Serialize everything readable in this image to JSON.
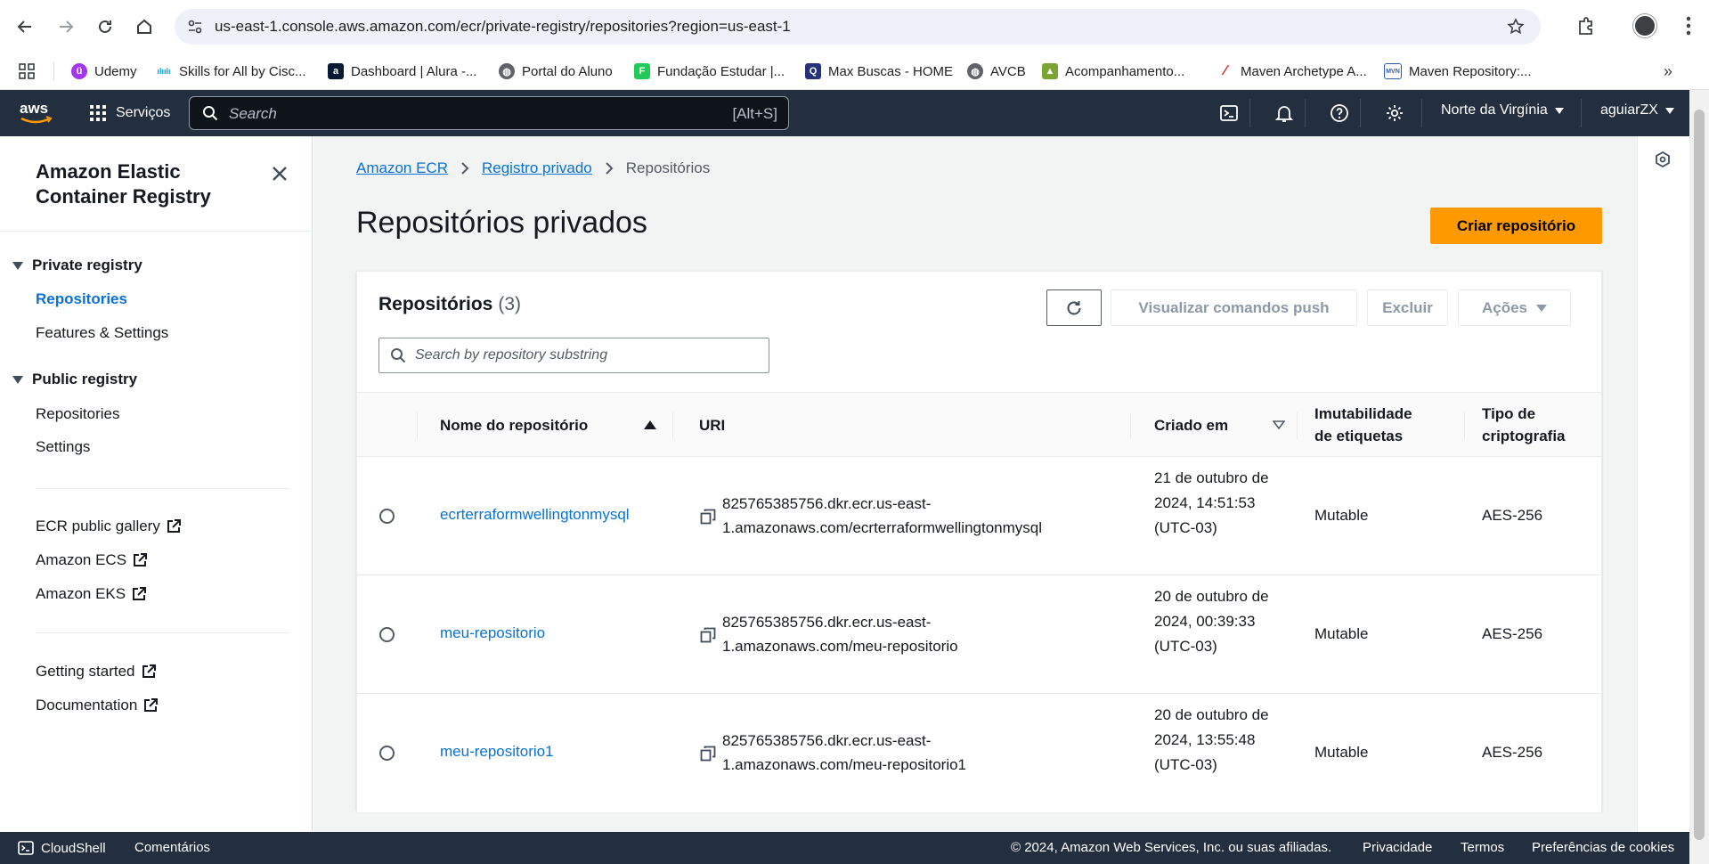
{
  "browser": {
    "url": "us-east-1.console.aws.amazon.com/ecr/private-registry/repositories?region=us-east-1",
    "bookmarks": [
      {
        "label": "Udemy",
        "icon": "udemy-icon",
        "color": "#a435f0"
      },
      {
        "label": "Skills for All by Cisc...",
        "icon": "cisco-icon",
        "color": "#049fd9"
      },
      {
        "label": "Dashboard | Alura -...",
        "icon": "alura-icon",
        "color": "#051933"
      },
      {
        "label": "Portal do Aluno",
        "icon": "globe-icon",
        "color": "#5f6368"
      },
      {
        "label": "Fundação Estudar |...",
        "icon": "estudar-icon",
        "color": "#24c95b"
      },
      {
        "label": "Max Buscas - HOME",
        "icon": "maxbuscas-icon",
        "color": "#26337a"
      },
      {
        "label": "AVCB",
        "icon": "globe-icon",
        "color": "#5f6368"
      },
      {
        "label": "Acompanhamento...",
        "icon": "acompanhamento-icon",
        "color": "#7aa532"
      },
      {
        "label": "Maven Archetype A...",
        "icon": "maven-feather-icon",
        "color": "#d22128"
      },
      {
        "label": "Maven Repository:...",
        "icon": "mvn-icon",
        "color": "#2f5fa8"
      }
    ]
  },
  "aws_nav": {
    "services_label": "Serviços",
    "search_placeholder": "Search",
    "search_shortcut": "[Alt+S]",
    "region": "Norte da Virgínia",
    "account": "aguiarZX"
  },
  "sidebar": {
    "title": "Amazon Elastic Container Registry",
    "private_registry": {
      "label": "Private registry",
      "items": [
        {
          "label": "Repositories",
          "active": true
        },
        {
          "label": "Features & Settings",
          "active": false
        }
      ]
    },
    "public_registry": {
      "label": "Public registry",
      "items": [
        {
          "label": "Repositories"
        },
        {
          "label": "Settings"
        }
      ]
    },
    "external_links": [
      "ECR public gallery",
      "Amazon ECS",
      "Amazon EKS"
    ],
    "help_links": [
      "Getting started",
      "Documentation"
    ]
  },
  "main": {
    "breadcrumb": [
      "Amazon ECR",
      "Registro privado",
      "Repositórios"
    ],
    "page_title": "Repositórios privados",
    "create_button": "Criar repositório",
    "panel": {
      "title": "Repositórios",
      "count": "(3)",
      "push_commands_button": "Visualizar comandos push",
      "delete_button": "Excluir",
      "actions_button": "Ações",
      "search_placeholder": "Search by repository substring"
    },
    "table": {
      "headers": {
        "name": "Nome do repositório",
        "uri": "URI",
        "created": "Criado em",
        "immutability_line1": "Imutabilidade",
        "immutability_line2": "de etiquetas",
        "encryption_line1": "Tipo de",
        "encryption_line2": "criptografia"
      },
      "rows": [
        {
          "name": "ecrterraformwellingtonmysql",
          "uri": "825765385756.dkr.ecr.us-east-1.amazonaws.com/ecrterraformwellingtonmysql",
          "created": "21 de outubro de 2024, 14:51:53 (UTC-03)",
          "immutability": "Mutable",
          "encryption": "AES-256"
        },
        {
          "name": "meu-repositorio",
          "uri": "825765385756.dkr.ecr.us-east-1.amazonaws.com/meu-repositorio",
          "created": "20 de outubro de 2024, 00:39:33 (UTC-03)",
          "immutability": "Mutable",
          "encryption": "AES-256"
        },
        {
          "name": "meu-repositorio1",
          "uri": "825765385756.dkr.ecr.us-east-1.amazonaws.com/meu-repositorio1",
          "created": "20 de outubro de 2024, 13:55:48 (UTC-03)",
          "immutability": "Mutable",
          "encryption": "AES-256"
        }
      ]
    }
  },
  "footer": {
    "cloudshell": "CloudShell",
    "feedback": "Comentários",
    "copyright": "© 2024, Amazon Web Services, Inc. ou suas afiliadas.",
    "privacy": "Privacidade",
    "terms": "Termos",
    "cookies": "Preferências de cookies"
  },
  "colors": {
    "aws_nav": "#232f3e",
    "link": "#0972d3",
    "primary_button": "#ff9900",
    "content_bg": "#f2f3f3"
  }
}
